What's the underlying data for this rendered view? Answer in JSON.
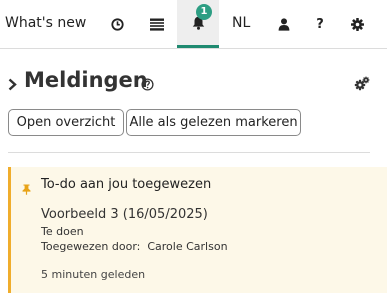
{
  "topbar": {
    "whats_new": "What's new",
    "notification_count": "1",
    "language": "NL",
    "icons": [
      "clock-icon",
      "list-icon",
      "bell-icon",
      "user-icon",
      "help-icon",
      "gear-icon"
    ]
  },
  "page": {
    "title": "Meldingen",
    "buttons": {
      "open_overview": "Open overzicht",
      "mark_all_read": "Alle als gelezen markeren"
    }
  },
  "notification": {
    "title": "To-do aan jou toegewezen",
    "item": "Voorbeeld 3 (16/05/2025)",
    "status": "Te doen",
    "assigned_by_label": "Toegewezen door:",
    "assigned_by": "Carole Carlson",
    "time": "5 minuten geleden"
  },
  "colors": {
    "accent": "#1f8a70",
    "badge": "#2d9e83",
    "card_bg": "#fdf8e8",
    "card_border": "#f0ad2c",
    "pin": "#e8a317"
  }
}
